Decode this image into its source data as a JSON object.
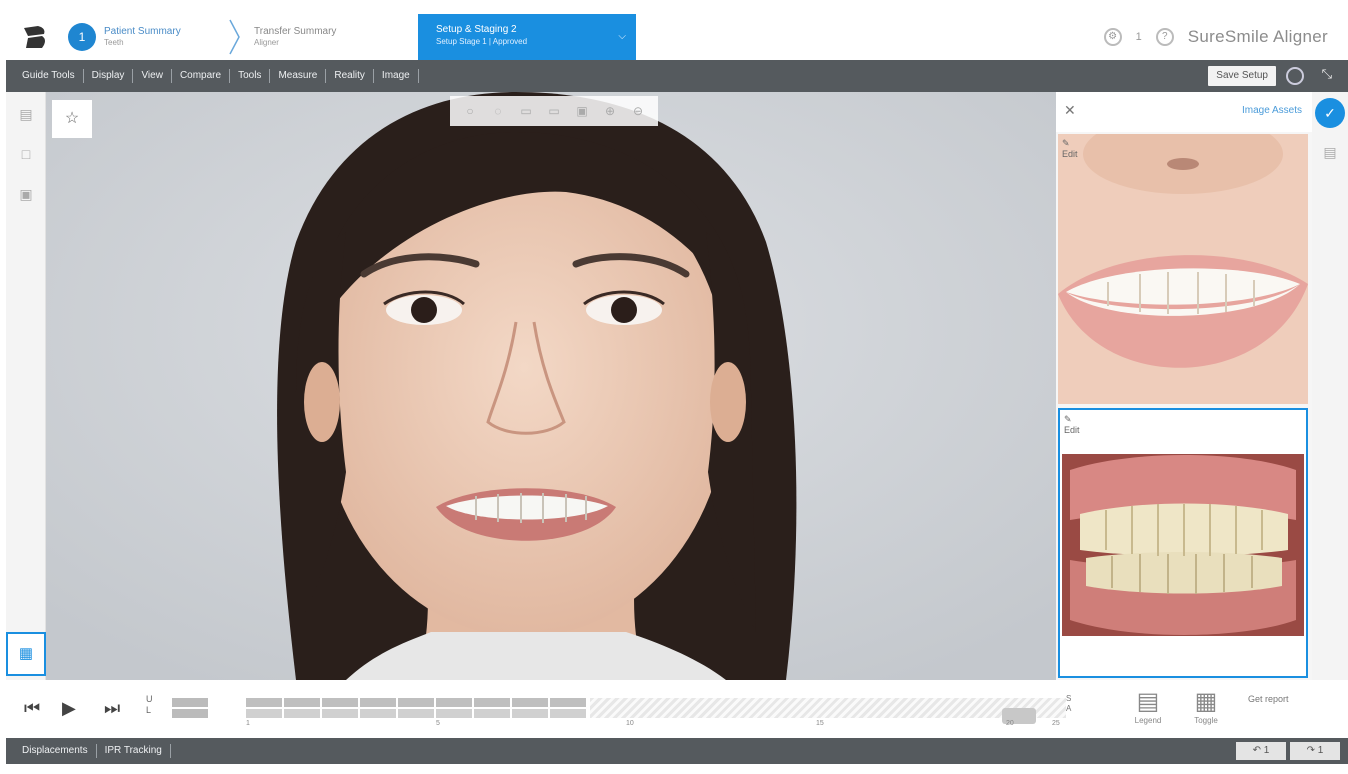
{
  "header": {
    "breadcrumbs": [
      {
        "title": "Patient Summary",
        "subtitle": "Teeth",
        "badge": "1"
      },
      {
        "title": "Transfer Summary",
        "subtitle": "Aligner"
      },
      {
        "title": "Setup & Staging 2",
        "subtitle": "Setup Stage 1 | Approved"
      }
    ],
    "help_count": "1",
    "app_name": "SureSmile Aligner"
  },
  "menu": {
    "items": [
      "Guide Tools",
      "Display",
      "View",
      "Compare",
      "Tools",
      "Measure",
      "Reality",
      "Image"
    ],
    "save_label": "Save Setup"
  },
  "right_panel": {
    "link_label": "Image Assets",
    "thumb_tool_label": "Edit"
  },
  "bottom": {
    "tabs": [
      "Displacements",
      "IPR Tracking"
    ],
    "undo_label": "↶ 1",
    "redo_label": "↷ 1"
  },
  "timeline": {
    "small_label_1": "U",
    "small_label_2": "L",
    "end_label_1": "S",
    "end_label_2": "A",
    "ticks": [
      "1",
      "5",
      "10",
      "15",
      "20",
      "25"
    ],
    "legend_label": "Legend",
    "toggle_label": "Toggle",
    "right_label": "Get report"
  },
  "colors": {
    "accent": "#1a8fe0",
    "menubar": "#555a5e",
    "viewer_bg": "#cfd2d6"
  }
}
